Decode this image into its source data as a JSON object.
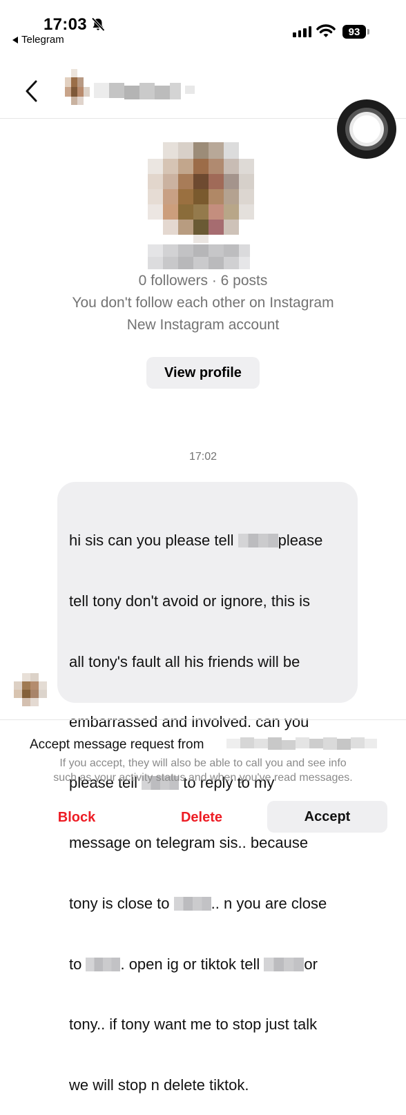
{
  "status_bar": {
    "time": "17:03",
    "back_app": "Telegram",
    "battery": "93",
    "icons": [
      "bell-muted-icon",
      "signal-icon",
      "wifi-icon",
      "battery-icon"
    ]
  },
  "header": {
    "back_icon": "chevron-left-icon",
    "name_redacted": true
  },
  "profile": {
    "stats": "0 followers · 6 posts",
    "follow_status": "You don't follow each other on Instagram",
    "account_note": "New Instagram account",
    "view_profile_label": "View profile"
  },
  "conversation": {
    "timestamp": "17:02",
    "message": {
      "lines": [
        [
          "hi sis can you please tell ",
          "█",
          "please"
        ],
        [
          "tell tony don't avoid or ignore, this is"
        ],
        [
          "all tony's fault all his friends will be"
        ],
        [
          "embarrassed and involved. can you"
        ],
        [
          "please tell ",
          "█",
          " to reply to my"
        ],
        [
          "message on telegram sis.. because"
        ],
        [
          "tony is close to ",
          "█",
          ".. n you are close"
        ],
        [
          "to ",
          "█",
          ". open ig or tiktok tell ",
          "█",
          "or"
        ],
        [
          "tony.. if tony want me to stop just talk"
        ],
        [
          "we will stop n delete tiktok."
        ]
      ]
    }
  },
  "request": {
    "title": "Accept message request from",
    "info_line1": "If you accept, they will also be able to call you and see info",
    "info_line2": "such as your activity status and when you've read messages.",
    "block_label": "Block",
    "delete_label": "Delete",
    "accept_label": "Accept",
    "danger_color": "#ed1c24"
  },
  "colors": {
    "bubble": "#efeff1",
    "secondary_text": "#737373",
    "assistive_touch": "#1c1c1c"
  }
}
